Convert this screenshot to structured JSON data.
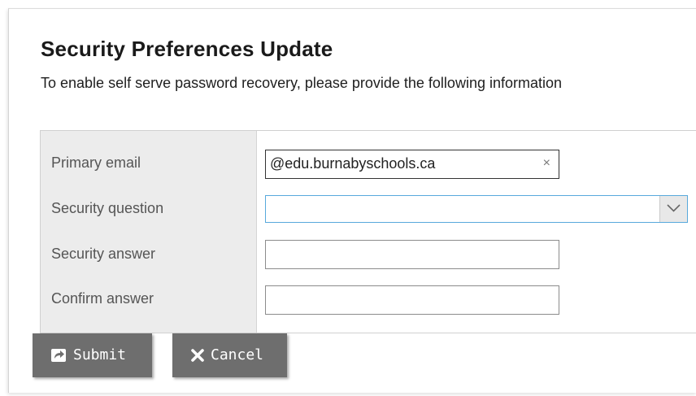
{
  "header": {
    "title": "Security Preferences Update",
    "subtitle": "To enable self serve password recovery, please provide the following information"
  },
  "form": {
    "primary_email": {
      "label": "Primary email",
      "value": "@edu.burnabyschools.ca",
      "clear_glyph": "×"
    },
    "security_question": {
      "label": "Security question",
      "value": "",
      "icon": "chevron-down-icon"
    },
    "security_answer": {
      "label": "Security answer",
      "value": ""
    },
    "confirm_answer": {
      "label": "Confirm answer",
      "value": ""
    }
  },
  "actions": {
    "submit": {
      "label": "Submit",
      "icon": "share-arrow-icon"
    },
    "cancel": {
      "label": "Cancel",
      "icon": "x-icon"
    }
  },
  "colors": {
    "button_bg": "#6e6e6e",
    "label_column_bg": "#ececec",
    "focus_border": "#58a9dc"
  }
}
